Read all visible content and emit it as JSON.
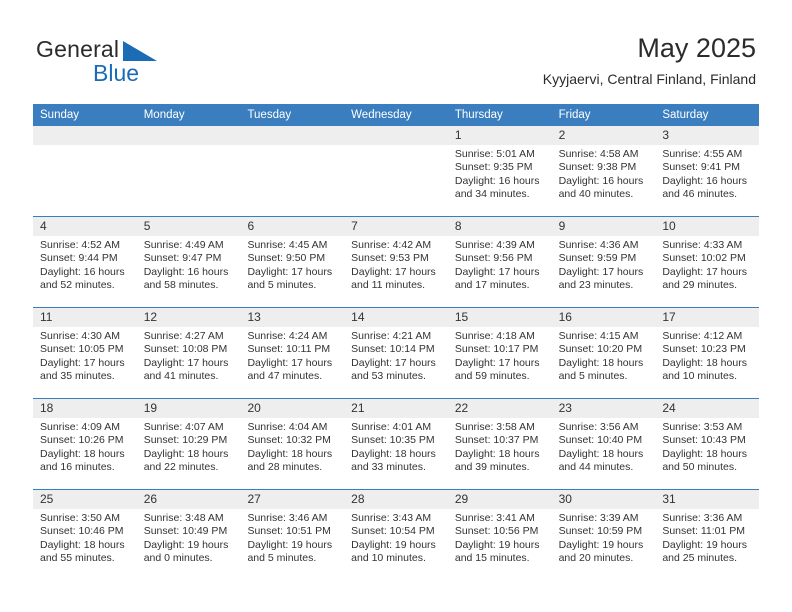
{
  "logo": {
    "word_one": "General",
    "word_two": "Blue",
    "triangle_color": "#1b6cb5",
    "icon": "triangle-icon"
  },
  "header": {
    "title": "May 2025",
    "subtitle": "Kyyjaervi, Central Finland, Finland"
  },
  "theme": {
    "header_blue": "#3a7ebf",
    "daynum_band": "#eeeeee",
    "text": "#333333"
  },
  "calendar": {
    "weekdays": [
      "Sunday",
      "Monday",
      "Tuesday",
      "Wednesday",
      "Thursday",
      "Friday",
      "Saturday"
    ],
    "weeks": [
      [
        {
          "day": "",
          "sunrise": "",
          "sunset": "",
          "daylight": ""
        },
        {
          "day": "",
          "sunrise": "",
          "sunset": "",
          "daylight": ""
        },
        {
          "day": "",
          "sunrise": "",
          "sunset": "",
          "daylight": ""
        },
        {
          "day": "",
          "sunrise": "",
          "sunset": "",
          "daylight": ""
        },
        {
          "day": "1",
          "sunrise": "Sunrise: 5:01 AM",
          "sunset": "Sunset: 9:35 PM",
          "daylight": "Daylight: 16 hours and 34 minutes."
        },
        {
          "day": "2",
          "sunrise": "Sunrise: 4:58 AM",
          "sunset": "Sunset: 9:38 PM",
          "daylight": "Daylight: 16 hours and 40 minutes."
        },
        {
          "day": "3",
          "sunrise": "Sunrise: 4:55 AM",
          "sunset": "Sunset: 9:41 PM",
          "daylight": "Daylight: 16 hours and 46 minutes."
        }
      ],
      [
        {
          "day": "4",
          "sunrise": "Sunrise: 4:52 AM",
          "sunset": "Sunset: 9:44 PM",
          "daylight": "Daylight: 16 hours and 52 minutes."
        },
        {
          "day": "5",
          "sunrise": "Sunrise: 4:49 AM",
          "sunset": "Sunset: 9:47 PM",
          "daylight": "Daylight: 16 hours and 58 minutes."
        },
        {
          "day": "6",
          "sunrise": "Sunrise: 4:45 AM",
          "sunset": "Sunset: 9:50 PM",
          "daylight": "Daylight: 17 hours and 5 minutes."
        },
        {
          "day": "7",
          "sunrise": "Sunrise: 4:42 AM",
          "sunset": "Sunset: 9:53 PM",
          "daylight": "Daylight: 17 hours and 11 minutes."
        },
        {
          "day": "8",
          "sunrise": "Sunrise: 4:39 AM",
          "sunset": "Sunset: 9:56 PM",
          "daylight": "Daylight: 17 hours and 17 minutes."
        },
        {
          "day": "9",
          "sunrise": "Sunrise: 4:36 AM",
          "sunset": "Sunset: 9:59 PM",
          "daylight": "Daylight: 17 hours and 23 minutes."
        },
        {
          "day": "10",
          "sunrise": "Sunrise: 4:33 AM",
          "sunset": "Sunset: 10:02 PM",
          "daylight": "Daylight: 17 hours and 29 minutes."
        }
      ],
      [
        {
          "day": "11",
          "sunrise": "Sunrise: 4:30 AM",
          "sunset": "Sunset: 10:05 PM",
          "daylight": "Daylight: 17 hours and 35 minutes."
        },
        {
          "day": "12",
          "sunrise": "Sunrise: 4:27 AM",
          "sunset": "Sunset: 10:08 PM",
          "daylight": "Daylight: 17 hours and 41 minutes."
        },
        {
          "day": "13",
          "sunrise": "Sunrise: 4:24 AM",
          "sunset": "Sunset: 10:11 PM",
          "daylight": "Daylight: 17 hours and 47 minutes."
        },
        {
          "day": "14",
          "sunrise": "Sunrise: 4:21 AM",
          "sunset": "Sunset: 10:14 PM",
          "daylight": "Daylight: 17 hours and 53 minutes."
        },
        {
          "day": "15",
          "sunrise": "Sunrise: 4:18 AM",
          "sunset": "Sunset: 10:17 PM",
          "daylight": "Daylight: 17 hours and 59 minutes."
        },
        {
          "day": "16",
          "sunrise": "Sunrise: 4:15 AM",
          "sunset": "Sunset: 10:20 PM",
          "daylight": "Daylight: 18 hours and 5 minutes."
        },
        {
          "day": "17",
          "sunrise": "Sunrise: 4:12 AM",
          "sunset": "Sunset: 10:23 PM",
          "daylight": "Daylight: 18 hours and 10 minutes."
        }
      ],
      [
        {
          "day": "18",
          "sunrise": "Sunrise: 4:09 AM",
          "sunset": "Sunset: 10:26 PM",
          "daylight": "Daylight: 18 hours and 16 minutes."
        },
        {
          "day": "19",
          "sunrise": "Sunrise: 4:07 AM",
          "sunset": "Sunset: 10:29 PM",
          "daylight": "Daylight: 18 hours and 22 minutes."
        },
        {
          "day": "20",
          "sunrise": "Sunrise: 4:04 AM",
          "sunset": "Sunset: 10:32 PM",
          "daylight": "Daylight: 18 hours and 28 minutes."
        },
        {
          "day": "21",
          "sunrise": "Sunrise: 4:01 AM",
          "sunset": "Sunset: 10:35 PM",
          "daylight": "Daylight: 18 hours and 33 minutes."
        },
        {
          "day": "22",
          "sunrise": "Sunrise: 3:58 AM",
          "sunset": "Sunset: 10:37 PM",
          "daylight": "Daylight: 18 hours and 39 minutes."
        },
        {
          "day": "23",
          "sunrise": "Sunrise: 3:56 AM",
          "sunset": "Sunset: 10:40 PM",
          "daylight": "Daylight: 18 hours and 44 minutes."
        },
        {
          "day": "24",
          "sunrise": "Sunrise: 3:53 AM",
          "sunset": "Sunset: 10:43 PM",
          "daylight": "Daylight: 18 hours and 50 minutes."
        }
      ],
      [
        {
          "day": "25",
          "sunrise": "Sunrise: 3:50 AM",
          "sunset": "Sunset: 10:46 PM",
          "daylight": "Daylight: 18 hours and 55 minutes."
        },
        {
          "day": "26",
          "sunrise": "Sunrise: 3:48 AM",
          "sunset": "Sunset: 10:49 PM",
          "daylight": "Daylight: 19 hours and 0 minutes."
        },
        {
          "day": "27",
          "sunrise": "Sunrise: 3:46 AM",
          "sunset": "Sunset: 10:51 PM",
          "daylight": "Daylight: 19 hours and 5 minutes."
        },
        {
          "day": "28",
          "sunrise": "Sunrise: 3:43 AM",
          "sunset": "Sunset: 10:54 PM",
          "daylight": "Daylight: 19 hours and 10 minutes."
        },
        {
          "day": "29",
          "sunrise": "Sunrise: 3:41 AM",
          "sunset": "Sunset: 10:56 PM",
          "daylight": "Daylight: 19 hours and 15 minutes."
        },
        {
          "day": "30",
          "sunrise": "Sunrise: 3:39 AM",
          "sunset": "Sunset: 10:59 PM",
          "daylight": "Daylight: 19 hours and 20 minutes."
        },
        {
          "day": "31",
          "sunrise": "Sunrise: 3:36 AM",
          "sunset": "Sunset: 11:01 PM",
          "daylight": "Daylight: 19 hours and 25 minutes."
        }
      ]
    ]
  }
}
